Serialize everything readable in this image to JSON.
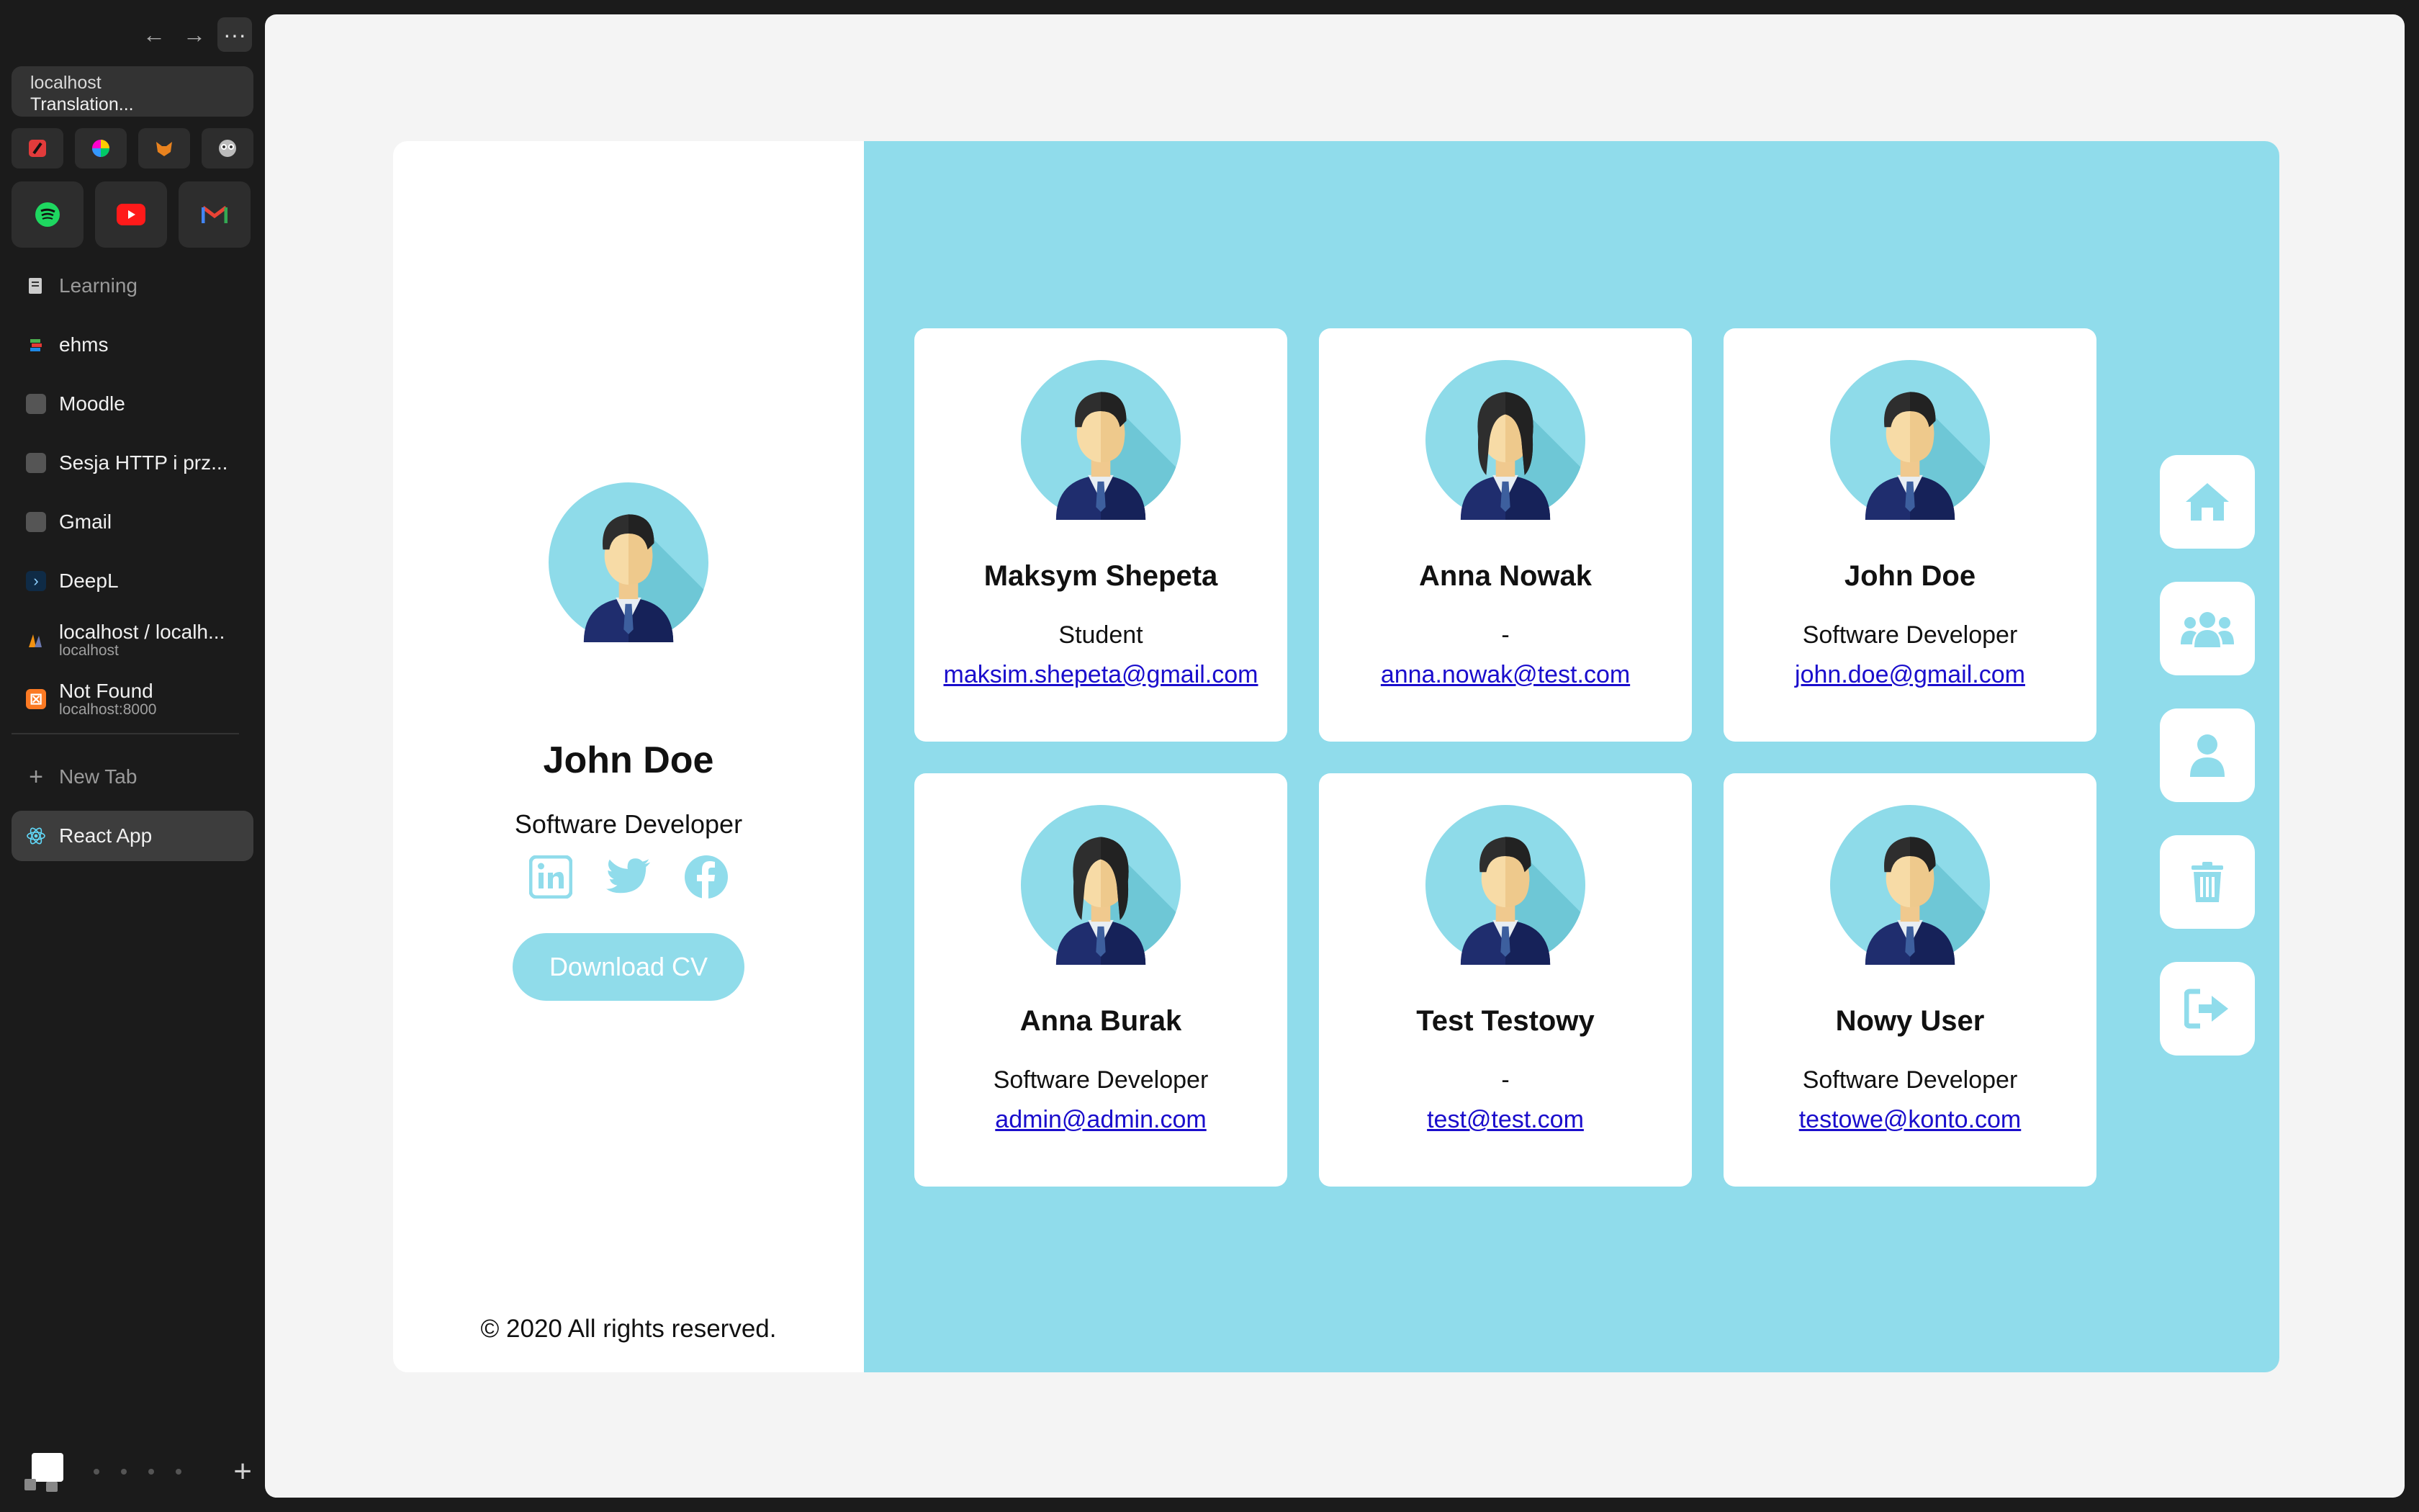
{
  "browser": {
    "url_host": "localhost",
    "url_title": "Translation...",
    "tabs": [
      {
        "label": "Learning",
        "icon": "learning-icon",
        "dim": true
      },
      {
        "label": "ehms",
        "icon": "books-icon"
      },
      {
        "label": "Moodle",
        "icon": "page-icon"
      },
      {
        "label": "Sesja HTTP i prz...",
        "icon": "page-icon"
      },
      {
        "label": "Gmail",
        "icon": "page-icon"
      },
      {
        "label": "DeepL",
        "icon": "deepl-icon"
      },
      {
        "label": "localhost / localh...",
        "sub": "localhost",
        "icon": "phpmyadmin-icon"
      },
      {
        "label": "Not Found",
        "sub": "localhost:8000",
        "icon": "xampp-icon"
      }
    ],
    "new_tab": "New Tab",
    "active_tab": "React App"
  },
  "profile": {
    "name": "John Doe",
    "role": "Software Developer",
    "download_label": "Download CV",
    "footer": "© 2020 All rights reserved."
  },
  "users": [
    {
      "name": "Maksym Shepeta",
      "role": "Student",
      "email": "maksim.shepeta@gmail.com",
      "gender": "male"
    },
    {
      "name": "Anna Nowak",
      "role": "-",
      "email": "anna.nowak@test.com",
      "gender": "female"
    },
    {
      "name": "John Doe",
      "role": "Software Developer",
      "email": "john.doe@gmail.com",
      "gender": "male"
    },
    {
      "name": "Anna Burak",
      "role": "Software Developer",
      "email": "admin@admin.com",
      "gender": "female"
    },
    {
      "name": "Test Testowy",
      "role": "-",
      "email": "test@test.com",
      "gender": "male"
    },
    {
      "name": "Nowy User",
      "role": "Software Developer",
      "email": "testowe@konto.com",
      "gender": "male"
    }
  ],
  "colors": {
    "accent": "#90dceb",
    "link": "#1a0dcc",
    "icon": "#90dceb"
  }
}
